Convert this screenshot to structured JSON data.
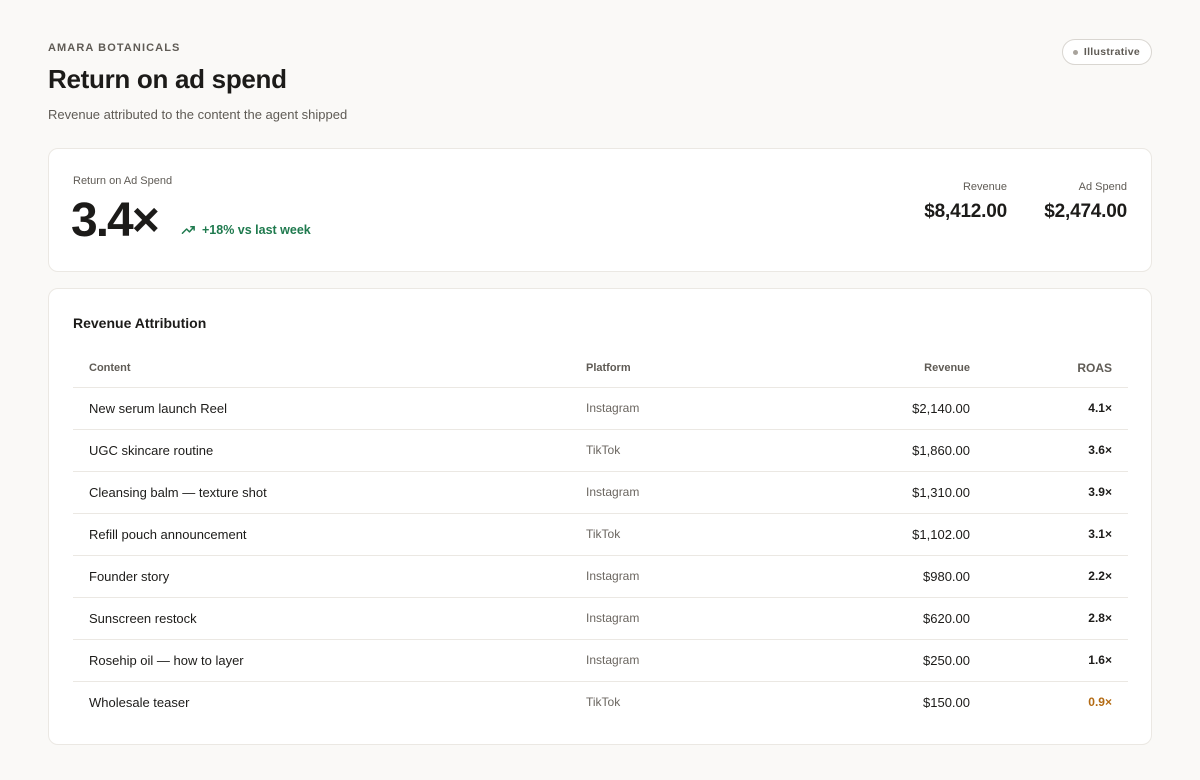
{
  "header": {
    "brand": "AMARA BOTANICALS",
    "title": "Return on ad spend",
    "subtitle": "Revenue attributed to the content the agent shipped",
    "tag": "Illustrative"
  },
  "kpi": {
    "label": "Return on Ad Spend",
    "value": "3.4×",
    "delta": "+18% vs last week",
    "delta_icon": "trending-up-icon",
    "revenue_label": "Revenue",
    "revenue_value": "$8,412.00",
    "spend_label": "Ad Spend",
    "spend_value": "$2,474.00"
  },
  "table": {
    "title": "Revenue Attribution",
    "columns": [
      "Content",
      "Platform",
      "Revenue",
      "ROAS"
    ],
    "rows": [
      {
        "content": "New serum launch Reel",
        "platform": "Instagram",
        "revenue": "$2,140.00",
        "roas": "4.1×",
        "low": false
      },
      {
        "content": "UGC skincare routine",
        "platform": "TikTok",
        "revenue": "$1,860.00",
        "roas": "3.6×",
        "low": false
      },
      {
        "content": "Cleansing balm — texture shot",
        "platform": "Instagram",
        "revenue": "$1,310.00",
        "roas": "3.9×",
        "low": false
      },
      {
        "content": "Refill pouch announcement",
        "platform": "TikTok",
        "revenue": "$1,102.00",
        "roas": "3.1×",
        "low": false
      },
      {
        "content": "Founder story",
        "platform": "Instagram",
        "revenue": "$980.00",
        "roas": "2.2×",
        "low": false
      },
      {
        "content": "Sunscreen restock",
        "platform": "Instagram",
        "revenue": "$620.00",
        "roas": "2.8×",
        "low": false
      },
      {
        "content": "Rosehip oil — how to layer",
        "platform": "Instagram",
        "revenue": "$250.00",
        "roas": "1.6×",
        "low": false
      },
      {
        "content": "Wholesale teaser",
        "platform": "TikTok",
        "revenue": "$150.00",
        "roas": "0.9×",
        "low": true
      }
    ]
  },
  "colors": {
    "positive": "#1f7a4e",
    "warning": "#b36a12"
  }
}
